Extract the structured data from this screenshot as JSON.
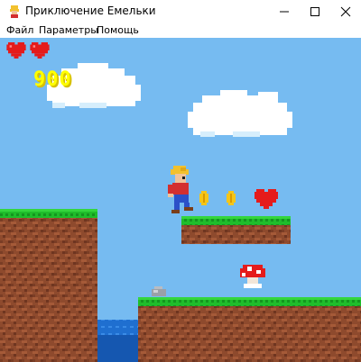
{
  "window": {
    "title": "Приключение Емельки",
    "controls": [
      "minimize-icon",
      "maximize-icon",
      "close-icon"
    ]
  },
  "menu": {
    "items": [
      "Файл",
      "Параметры",
      "Помощь"
    ]
  },
  "hud": {
    "lives": 2,
    "score": "900"
  },
  "colors": {
    "sky": "#76bbf1",
    "grass": "#1fbd2b",
    "dirt": "#8e4a2d",
    "water": "#1f6fd0",
    "heart": "#e51b1b",
    "coin": "#f5c518",
    "score": "#ffff00"
  },
  "scene": {
    "items": [
      "hero",
      "coin",
      "coin",
      "heart",
      "mushroom",
      "rock"
    ]
  }
}
